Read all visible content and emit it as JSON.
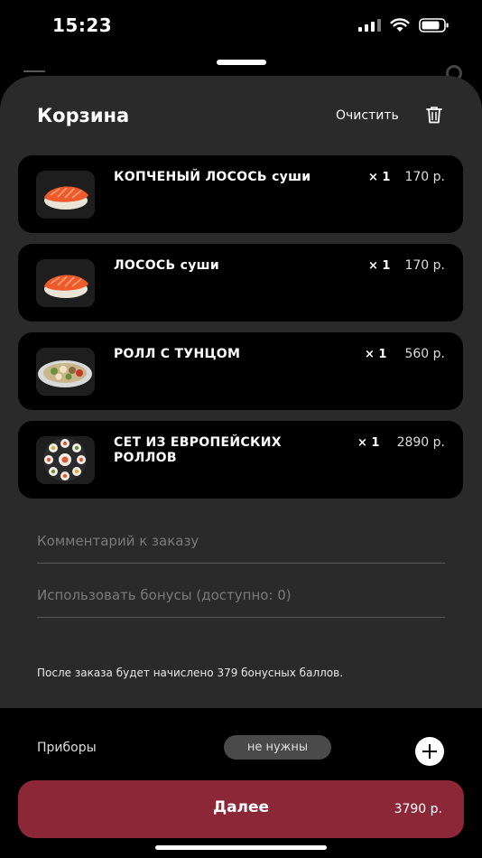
{
  "status": {
    "time": "15:23"
  },
  "sheet": {
    "title": "Корзина",
    "clear_label": "Очистить"
  },
  "cart": {
    "items": [
      {
        "name": "КОПЧЕНЫЙ  ЛОСОСЬ суши",
        "qty": "× 1",
        "price": "170 р.",
        "image": "salmon-nigiri"
      },
      {
        "name": "ЛОСОСЬ суши",
        "qty": "× 1",
        "price": "170 р.",
        "image": "salmon-nigiri"
      },
      {
        "name": "РОЛЛ С  ТУНЦОМ",
        "qty": "× 1",
        "price": "560 р.",
        "image": "tuna-roll-plate"
      },
      {
        "name": "СЕТ ИЗ ЕВРОПЕЙСКИХ РОЛЛОВ",
        "qty": "× 1",
        "price": "2890 р.",
        "image": "roll-set-platter"
      }
    ]
  },
  "form": {
    "comment_placeholder": "Комментарий к заказу",
    "bonus_placeholder": "Использовать бонусы (доступно: 0)",
    "bonus_note": "После заказа будет начислено 379 бонусных баллов."
  },
  "cutlery": {
    "label": "Приборы",
    "value": "не нужны"
  },
  "checkout": {
    "button_label": "Далее",
    "total": "3790 р.",
    "accent_color": "#8b2737"
  }
}
